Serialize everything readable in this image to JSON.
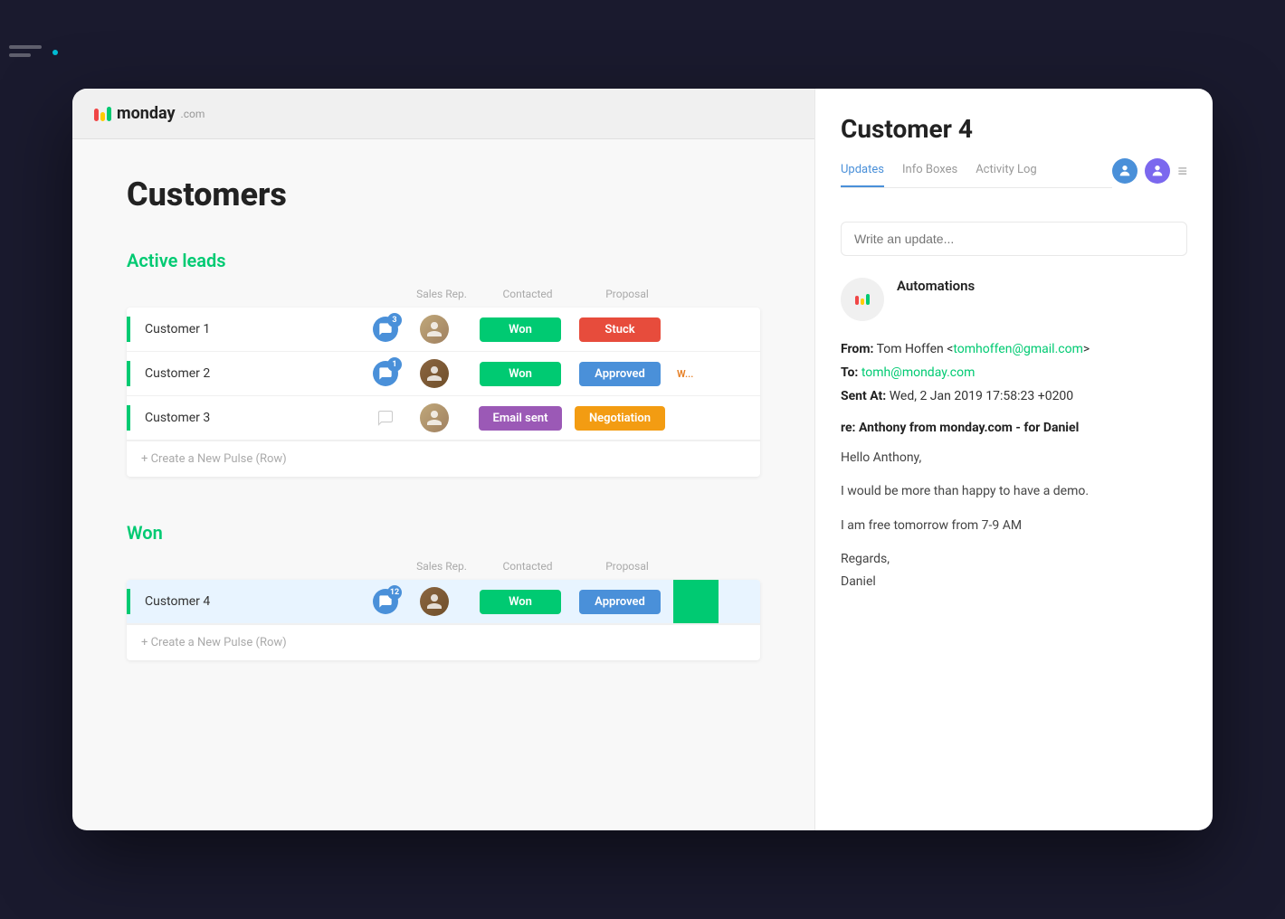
{
  "app": {
    "logo_text": "monday",
    "logo_suffix": ".com"
  },
  "board": {
    "title": "Customers",
    "sections": [
      {
        "id": "active-leads",
        "title": "Active leads",
        "color": "#00ca72",
        "columns": [
          "",
          "Sales Rep.",
          "Contacted",
          "Proposal",
          ""
        ],
        "rows": [
          {
            "name": "Customer 1",
            "chat_count": "3",
            "chat_filled": true,
            "contacted": "Won",
            "contacted_color": "won",
            "proposal": "Stuck",
            "proposal_color": "stuck",
            "extra": ""
          },
          {
            "name": "Customer 2",
            "chat_count": "1",
            "chat_filled": true,
            "contacted": "Won",
            "contacted_color": "won",
            "proposal": "Approved",
            "proposal_color": "approved",
            "extra": "W..."
          },
          {
            "name": "Customer 3",
            "chat_count": "",
            "chat_filled": false,
            "contacted": "Email sent",
            "contacted_color": "email",
            "proposal": "Negotiation",
            "proposal_color": "negotiation",
            "extra": ""
          }
        ],
        "create_label": "+ Create a New Pulse (Row)"
      },
      {
        "id": "won",
        "title": "Won",
        "color": "#00ca72",
        "columns": [
          "",
          "Sales Rep.",
          "Contacted",
          "Proposal",
          ""
        ],
        "rows": [
          {
            "name": "Customer 4",
            "chat_count": "12",
            "chat_filled": true,
            "contacted": "Won",
            "contacted_color": "won",
            "proposal": "Approved",
            "proposal_color": "approved",
            "extra": "",
            "selected": true
          }
        ],
        "create_label": "+ Create a New Pulse (Row)"
      }
    ]
  },
  "detail_panel": {
    "title": "Customer 4",
    "tabs": [
      "Updates",
      "Info Boxes",
      "Activity Log"
    ],
    "active_tab": "Updates",
    "update_placeholder": "Write an update...",
    "automations_label": "Automations",
    "email": {
      "from_label": "From:",
      "from_name": "Tom Hoffen",
      "from_email": "tomhoffen@gmail.com",
      "to_label": "To:",
      "to_email": "tomh@monday.com",
      "sent_label": "Sent At:",
      "sent_date": "Wed, 2 Jan 2019 17:58:23 +0200",
      "subject": "re: Anthony from monday.com - for Daniel",
      "greeting": "Hello Anthony,",
      "body1": "I would be more than happy to have a demo.",
      "body2": "I am free tomorrow from 7-9 AM",
      "sign_off": "Regards,",
      "signature": "Daniel"
    }
  }
}
